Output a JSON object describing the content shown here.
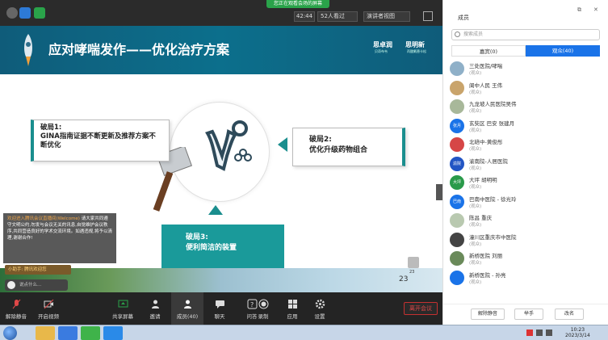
{
  "topbar": {
    "share_banner": "您正在观看会场的屏幕",
    "timer": "42:44",
    "watching": "52人看过",
    "view_mode": "演讲者视图"
  },
  "slide": {
    "title": "应对哮喘发作——优化治疗方案",
    "logo1": "思卓润",
    "logo1_sub": "贝奇布韦",
    "logo2": "思明新",
    "logo2_sub": "丙酸氟替卡松",
    "box1_title": "破局1:",
    "box1_text": "GINA指南证据不断更新及推荐方案不断优化",
    "box2_title": "破局2:",
    "box2_text": "优化升级药物组合",
    "box3_title": "破局3:",
    "box3_text": "便利简洁的装置",
    "page_number": "23",
    "like_count": "23"
  },
  "chat": {
    "highlight": "欢迎进入腾讯会议直播间(Welcome)",
    "body": "请大家共同遵守文明公约,勿发与会议无关的讯息,自觉维护会议秩序,共同营造良好的学术交流环境。如遇违规,将予以清理,谢谢合作!",
    "assistant": "小助手: 腾讯欢迎您",
    "input_placeholder": "说点什么..."
  },
  "toolbar": {
    "mute": "解除静音",
    "video": "开启视频",
    "share": "共享屏幕",
    "invite": "邀请",
    "members": "成员(40)",
    "chat": "聊天",
    "qa": "问答",
    "record": "录制",
    "apps": "应用",
    "settings": "设置",
    "leave": "离开会议"
  },
  "panel": {
    "title": "成员",
    "search_placeholder": "搜索成员",
    "tab_host": "嘉宾(0)",
    "tab_viewers": "观众(40)",
    "members": [
      {
        "name": "三处医院/哮喘",
        "role": "(观众)",
        "color": "#8fb0c8",
        "label": ""
      },
      {
        "name": "阆中人民 王伟",
        "role": "(观众)",
        "color": "#c9a46b",
        "label": ""
      },
      {
        "name": "九龙坡人民医院吴伟",
        "role": "(观众)",
        "color": "#a8b89a",
        "label": ""
      },
      {
        "name": "玄奘区 巴安 张建月",
        "role": "(观众)",
        "color": "#1a73e8",
        "label": "张月"
      },
      {
        "name": "北碚中-黄俊彤",
        "role": "(观众)",
        "color": "#d64646",
        "label": ""
      },
      {
        "name": "渝南院-人居医院",
        "role": "(观众)",
        "color": "#2255c4",
        "label": "渝院"
      },
      {
        "name": "大坪 胡明明",
        "role": "(观众)",
        "color": "#2a9a4a",
        "label": "大坪"
      },
      {
        "name": "巴南中医院 - 徐光玲",
        "role": "(观众)",
        "color": "#1a73e8",
        "label": "巴南"
      },
      {
        "name": "陈昌 重庆",
        "role": "(观众)",
        "color": "#b9c9b0",
        "label": ""
      },
      {
        "name": "潼川区重庆市中医院",
        "role": "(观众)",
        "color": "#444",
        "label": ""
      },
      {
        "name": "新桥医院 刘丽",
        "role": "(观众)",
        "color": "#6a8a5a",
        "label": ""
      },
      {
        "name": "新桥医院 - 孙亮",
        "role": "(观众)",
        "color": "#1a73e8",
        "label": ""
      }
    ],
    "btn_mute_all": "解除静音",
    "btn_hand": "举手",
    "btn_rename": "改名"
  },
  "taskbar": {
    "time": "10:23",
    "date": "2023/3/14"
  }
}
